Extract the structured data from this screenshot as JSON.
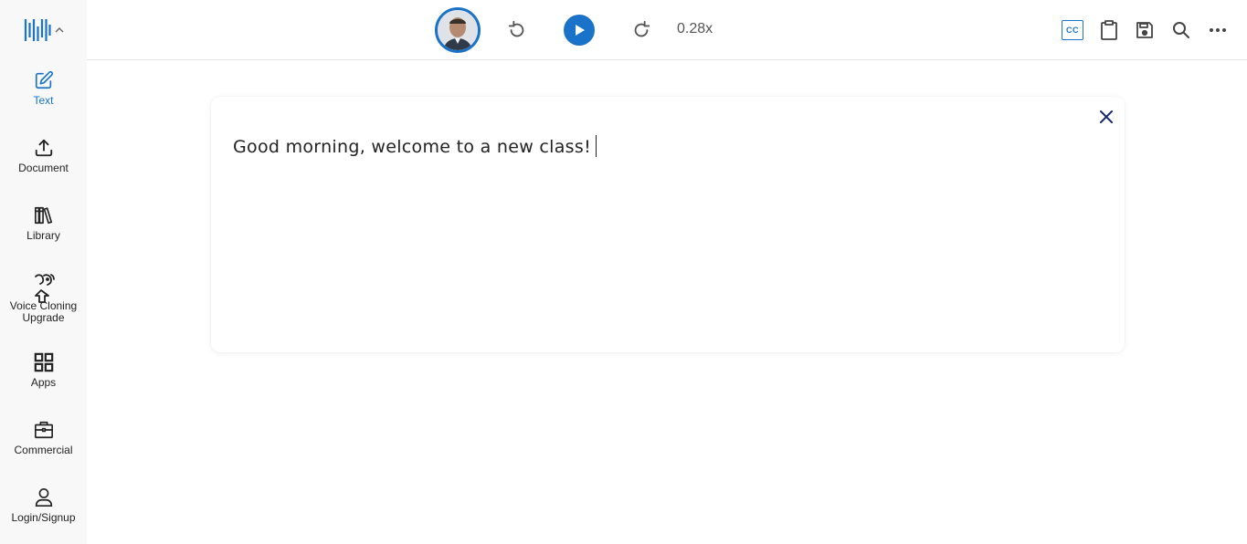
{
  "sidebar": {
    "items": [
      {
        "label": "Text",
        "icon": "edit-icon",
        "active": true
      },
      {
        "label": "Document",
        "icon": "upload-icon"
      },
      {
        "label": "Library",
        "icon": "library-icon"
      },
      {
        "label": "Voice Cloning",
        "label2": "Upgrade",
        "icon": "voice-cloning-icon"
      },
      {
        "label": "Apps",
        "icon": "apps-grid-icon"
      },
      {
        "label": "Commercial",
        "icon": "briefcase-icon"
      },
      {
        "label": "Login/Signup",
        "icon": "user-icon"
      }
    ]
  },
  "player": {
    "speed": "0.28x"
  },
  "editor": {
    "text": "Good morning, welcome to a new class!"
  },
  "toolbar": {
    "cc_label": "CC"
  },
  "colors": {
    "accent": "#1a73c9",
    "close": "#1a2a6c",
    "sidebar_bg": "#f8f8f9"
  }
}
